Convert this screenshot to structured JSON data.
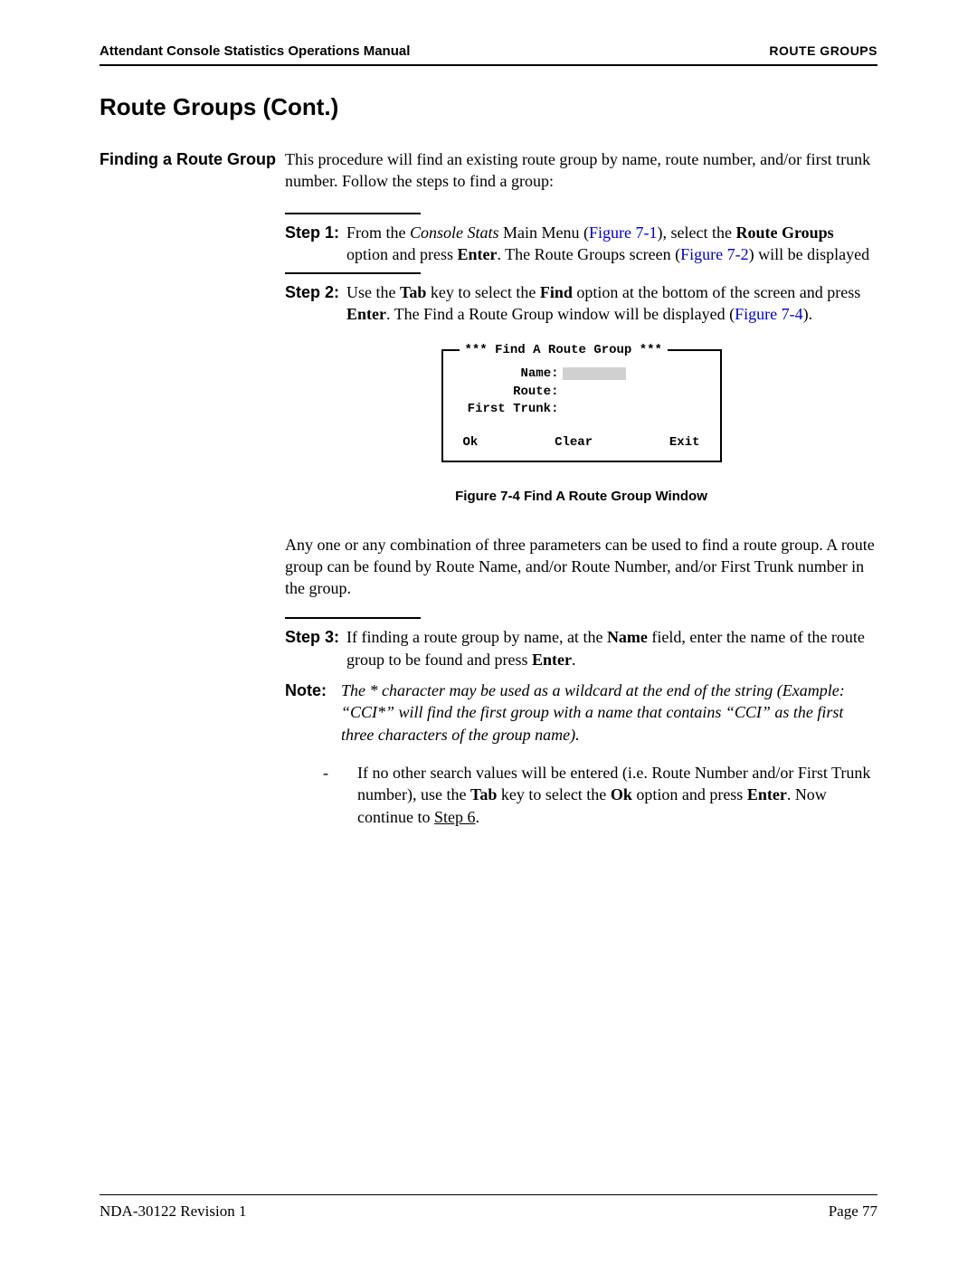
{
  "header": {
    "left": "Attendant Console Statistics Operations Manual",
    "right": "ROUTE GROUPS"
  },
  "section_title": "Route Groups (Cont.)",
  "subtitle": "Finding a Route Group",
  "intro": "This procedure will find an existing route group by name, route number, and/or first trunk number. Follow the steps to find a group:",
  "step1": {
    "label": "Step 1:",
    "t1": "From the ",
    "t2": "Console Stats",
    "t3": " Main Menu (",
    "link1": "Figure 7-1",
    "t4": "), select the ",
    "t5": "Route Groups",
    "t6": " option and press ",
    "t7": "Enter",
    "t8": ". The Route Groups screen (",
    "link2": "Figure 7-2",
    "t9": ") will be displayed"
  },
  "step2": {
    "label": "Step 2:",
    "t1": "Use the ",
    "t2": "Tab",
    "t3": " key to select the ",
    "t4": "Find",
    "t5": " option at the bottom of the screen and press ",
    "t6": "Enter",
    "t7": ". The Find a Route Group window will be displayed (",
    "link": "Figure 7-4",
    "t8": ")."
  },
  "figure": {
    "legend": "*** Find A Route Group ***",
    "name_label": "Name:",
    "route_label": "Route:",
    "first_trunk_label": "First Trunk:",
    "ok": "Ok",
    "clear": "Clear",
    "exit": "Exit",
    "caption": "Figure 7-4   Find A Route Group Window"
  },
  "para_mid": "Any one or any combination of three parameters can be used to find a route group. A route group can be found by Route Name, and/or Route Number, and/or First Trunk number in the group.",
  "step3": {
    "label": "Step 3:",
    "t1": "If finding a route group by name, at the ",
    "t2": "Name",
    "t3": " field, enter the name of the route group to be found and press ",
    "t4": "Enter",
    "t5": "."
  },
  "note": {
    "label": "Note:",
    "body": "The * character may be used as a wildcard at the end of the string (Example: “CCI*” will find the first group with a name that contains “CCI” as the first three characters of the group name)."
  },
  "bullet": {
    "t1": "If no other search values will be entered (i.e. Route Number and/or First Trunk number), use the ",
    "t2": "Tab",
    "t3": " key to select the ",
    "t4": "Ok",
    "t5": " option and press ",
    "t6": "Enter",
    "t7": ". Now continue to ",
    "t8": "Step 6",
    "t9": "."
  },
  "footer": {
    "left": "NDA-30122   Revision 1",
    "right": "Page 77"
  }
}
